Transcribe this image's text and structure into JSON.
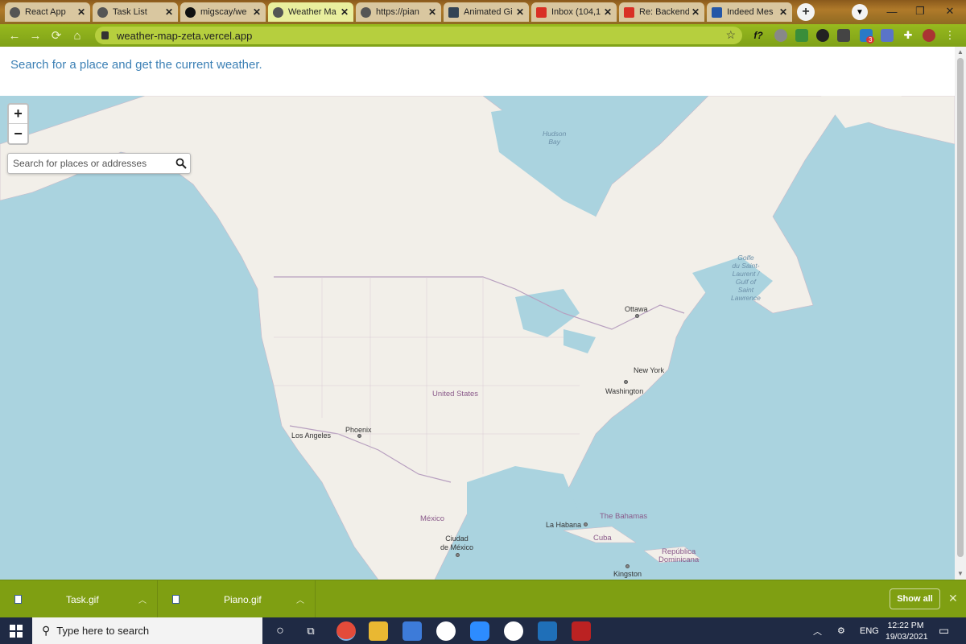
{
  "browser": {
    "tabs": [
      {
        "label": "React App",
        "icon": "globe-icon"
      },
      {
        "label": "Task List",
        "icon": "globe-icon"
      },
      {
        "label": "migscay/we",
        "icon": "github-icon"
      },
      {
        "label": "Weather Ma",
        "icon": "globe-icon",
        "active": true
      },
      {
        "label": "https://pian",
        "icon": "globe-icon"
      },
      {
        "label": "Animated Gi",
        "icon": "image-icon"
      },
      {
        "label": "Inbox (104,1",
        "icon": "gmail-icon"
      },
      {
        "label": "Re: Backend",
        "icon": "gmail-icon"
      },
      {
        "label": "Indeed Mes",
        "icon": "indeed-icon"
      }
    ],
    "url": "weather-map-zeta.vercel.app",
    "extension_badge": "3"
  },
  "page": {
    "tagline": "Search for a place and get the current weather.",
    "search_placeholder": "Search for places or addresses",
    "zoom_in_label": "+",
    "zoom_out_label": "−"
  },
  "map_labels": {
    "hudson_bay": "Hudson\nBay",
    "golfe": "Golfe\ndu Saint-\nLaurent /\nGulf of\nSaint\nLawrence",
    "ottawa": "Ottawa",
    "new_york": "New York",
    "washington": "Washington",
    "united_states": "United States",
    "phoenix": "Phoenix",
    "los_angeles": "Los Angeles",
    "mexico_country": "México",
    "ciudad_de_mexico": "Ciudad\nde México",
    "la_habana": "La Habana",
    "bahamas": "The Bahamas",
    "cuba": "Cuba",
    "republica_dominicana": "República\nDominicana",
    "kingston": "Kingston"
  },
  "downloads": {
    "items": [
      {
        "name": "Task.gif"
      },
      {
        "name": "Piano.gif"
      }
    ],
    "show_all_label": "Show all"
  },
  "taskbar": {
    "search_placeholder": "Type here to search",
    "language": "ENG",
    "time": "12:22 PM",
    "date": "19/03/2021"
  }
}
